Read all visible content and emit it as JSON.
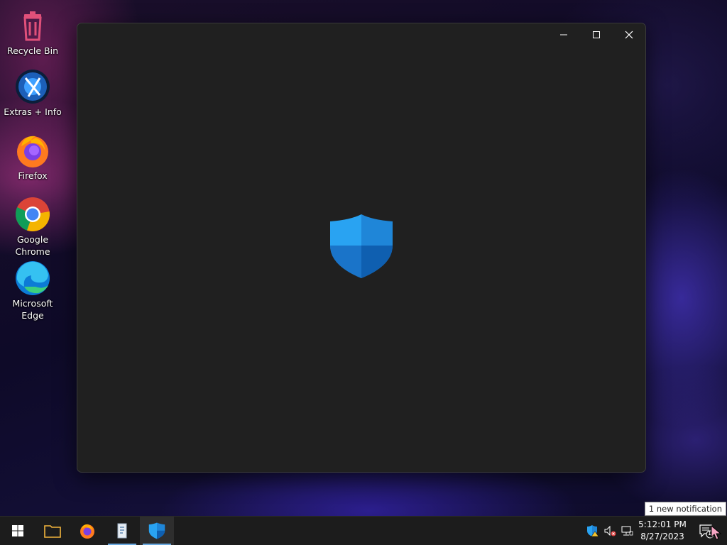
{
  "desktop": {
    "icons": [
      {
        "label": "Recycle Bin",
        "icon": "recycle-bin-icon"
      },
      {
        "label": "Extras + Info",
        "icon": "extras-info-icon"
      },
      {
        "label": "Firefox",
        "icon": "firefox-icon"
      },
      {
        "label": "Google Chrome",
        "icon": "chrome-icon"
      },
      {
        "label": "Microsoft Edge",
        "icon": "edge-icon"
      }
    ]
  },
  "window": {
    "app_icon": "defender-shield-icon",
    "controls": [
      "minimize-icon",
      "maximize-icon",
      "close-icon"
    ]
  },
  "taskbar": {
    "items": [
      "start-icon",
      "file-explorer-icon",
      "firefox-icon",
      "notepad-icon",
      "windows-security-icon"
    ],
    "tray": [
      "security-warning-icon",
      "volume-muted-icon",
      "network-icon"
    ],
    "time": "5:12:01 PM",
    "date": "8/27/2023",
    "notification_count": "1",
    "tooltip": "1 new notification"
  },
  "colors": {
    "window_bg": "#202020",
    "taskbar_bg": "#1c1c1c",
    "shield_light": "#29a3f2",
    "shield_dark": "#0f5fb0"
  }
}
